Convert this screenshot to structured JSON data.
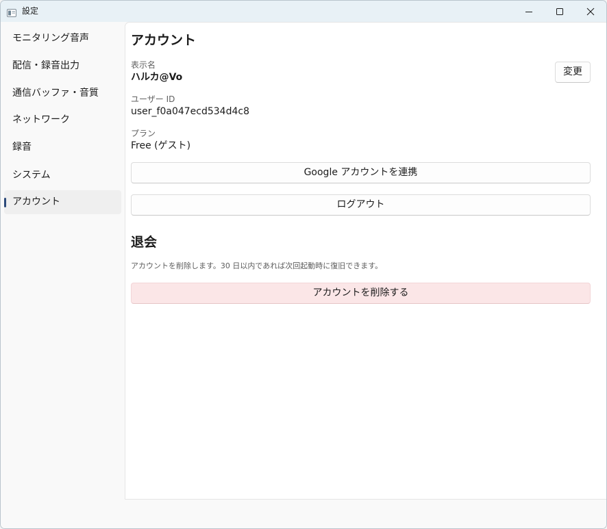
{
  "window": {
    "title": "設定"
  },
  "sidebar": {
    "items": [
      {
        "label": "モニタリング音声"
      },
      {
        "label": "配信・録音出力"
      },
      {
        "label": "通信バッファ・音質"
      },
      {
        "label": "ネットワーク"
      },
      {
        "label": "録音"
      },
      {
        "label": "システム"
      },
      {
        "label": "アカウント",
        "active": true
      }
    ]
  },
  "account": {
    "heading": "アカウント",
    "display_name_label": "表示名",
    "display_name_value": "ハルカ@Vo",
    "change_button": "変更",
    "user_id_label": "ユーザー ID",
    "user_id_value": "user_f0a047ecd534d4c8",
    "plan_label": "プラン",
    "plan_value": "Free (ゲスト)",
    "link_google_button": "Google アカウントを連携",
    "logout_button": "ログアウト"
  },
  "withdraw": {
    "heading": "退会",
    "note": "アカウントを削除します。30 日以内であれば次回起動時に復旧できます。",
    "delete_button": "アカウントを削除する"
  },
  "colors": {
    "accent": "#2c4a7a",
    "titlebar": "#e8f1f6",
    "danger_bg": "#fbe6e7"
  },
  "icons": {
    "app": "settings-window-icon",
    "minimize": "minimize-icon",
    "maximize": "maximize-icon",
    "close": "close-icon"
  }
}
